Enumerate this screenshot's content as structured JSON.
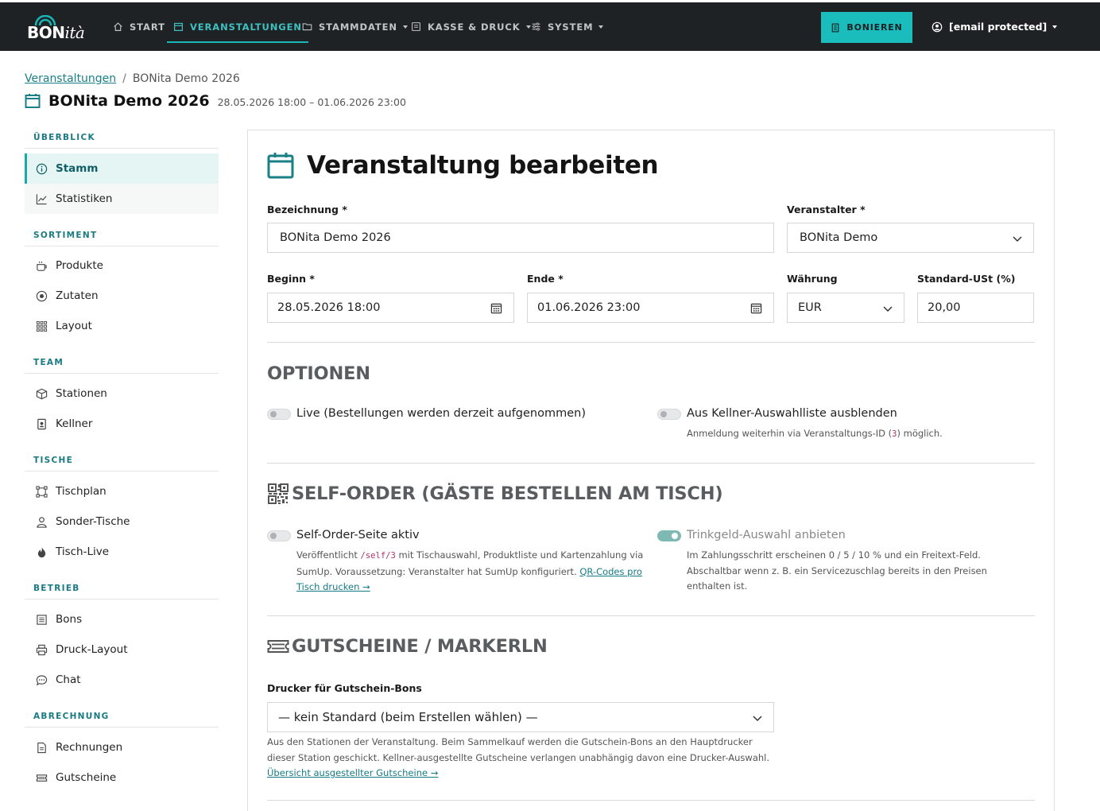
{
  "brand": {
    "bon": "BON",
    "ita": "ità"
  },
  "nav": {
    "items": [
      {
        "label": "START"
      },
      {
        "label": "VERANSTALTUNGEN"
      },
      {
        "label": "STAMMDATEN"
      },
      {
        "label": "KASSE & DRUCK"
      },
      {
        "label": "SYSTEM"
      }
    ],
    "bonieren": "BONIEREN",
    "user": "[email protected]"
  },
  "breadcrumb": {
    "parent": "Veranstaltungen",
    "current": "BONita Demo 2026"
  },
  "header": {
    "title": "BONita Demo 2026",
    "dates": "28.05.2026 18:00 – 01.06.2026 23:00"
  },
  "sidebar": {
    "sections": [
      {
        "title": "ÜBERBLICK",
        "items": [
          "Stamm",
          "Statistiken"
        ]
      },
      {
        "title": "SORTIMENT",
        "items": [
          "Produkte",
          "Zutaten",
          "Layout"
        ]
      },
      {
        "title": "TEAM",
        "items": [
          "Stationen",
          "Kellner"
        ]
      },
      {
        "title": "TISCHE",
        "items": [
          "Tischplan",
          "Sonder-Tische",
          "Tisch-Live"
        ]
      },
      {
        "title": "BETRIEB",
        "items": [
          "Bons",
          "Druck-Layout",
          "Chat"
        ]
      },
      {
        "title": "ABRECHNUNG",
        "items": [
          "Rechnungen",
          "Gutscheine"
        ]
      }
    ]
  },
  "form": {
    "title": "Veranstaltung bearbeiten",
    "bezeichnung": {
      "label": "Bezeichnung *",
      "value": "BONita Demo 2026"
    },
    "veranstalter": {
      "label": "Veranstalter *",
      "value": "BONita Demo"
    },
    "beginn": {
      "label": "Beginn *",
      "value": "28.05.2026 18:00"
    },
    "ende": {
      "label": "Ende *",
      "value": "01.06.2026 23:00"
    },
    "waehrung": {
      "label": "Währung",
      "value": "EUR"
    },
    "ust": {
      "label": "Standard-USt (%)",
      "value": "20,00"
    }
  },
  "optionen": {
    "title": "OPTIONEN",
    "live": {
      "label": "Live (Bestellungen werden derzeit aufgenommen)",
      "on": false
    },
    "kellner": {
      "label": "Aus Kellner-Auswahlliste ausblenden",
      "on": false,
      "help_pre": "Anmeldung weiterhin via Veranstaltungs-ID (",
      "help_code": "3",
      "help_post": ") möglich."
    }
  },
  "selforder": {
    "title": "SELF-ORDER (GÄSTE BESTELLEN AM TISCH)",
    "aktiv": {
      "label": "Self-Order-Seite aktiv",
      "on": false,
      "help_pre": "Veröffentlicht ",
      "help_code": "/self/3",
      "help_mid": " mit Tischauswahl, Produktliste und Kartenzahlung via SumUp. Voraussetzung: Veranstalter hat SumUp konfiguriert. ",
      "help_link": "QR-Codes pro Tisch drucken →"
    },
    "trinkgeld": {
      "label": "Trinkgeld-Auswahl anbieten",
      "on": true,
      "help": "Im Zahlungsschritt erscheinen 0 / 5 / 10 % und ein Freitext-Feld. Abschaltbar wenn z. B. ein Servicezuschlag bereits in den Preisen enthalten ist."
    }
  },
  "gutscheine": {
    "title": "GUTSCHEINE / MARKERLN",
    "drucker_label": "Drucker für Gutschein-Bons",
    "drucker_value": "— kein Standard (beim Erstellen wählen) —",
    "help": "Aus den Stationen der Veranstaltung. Beim Sammelkauf werden die Gutschein-Bons an den Hauptdrucker dieser Station geschickt. Kellner-ausgestellte Gutscheine verlangen unabhängig davon eine Drucker-Auswahl. ",
    "help_link": "Übersicht ausgestellter Gutscheine →"
  },
  "colors": {
    "accent": "#1bbcbc",
    "nav_bg": "#1f2224",
    "link": "#1a7f87",
    "section": "#1a7a82"
  }
}
